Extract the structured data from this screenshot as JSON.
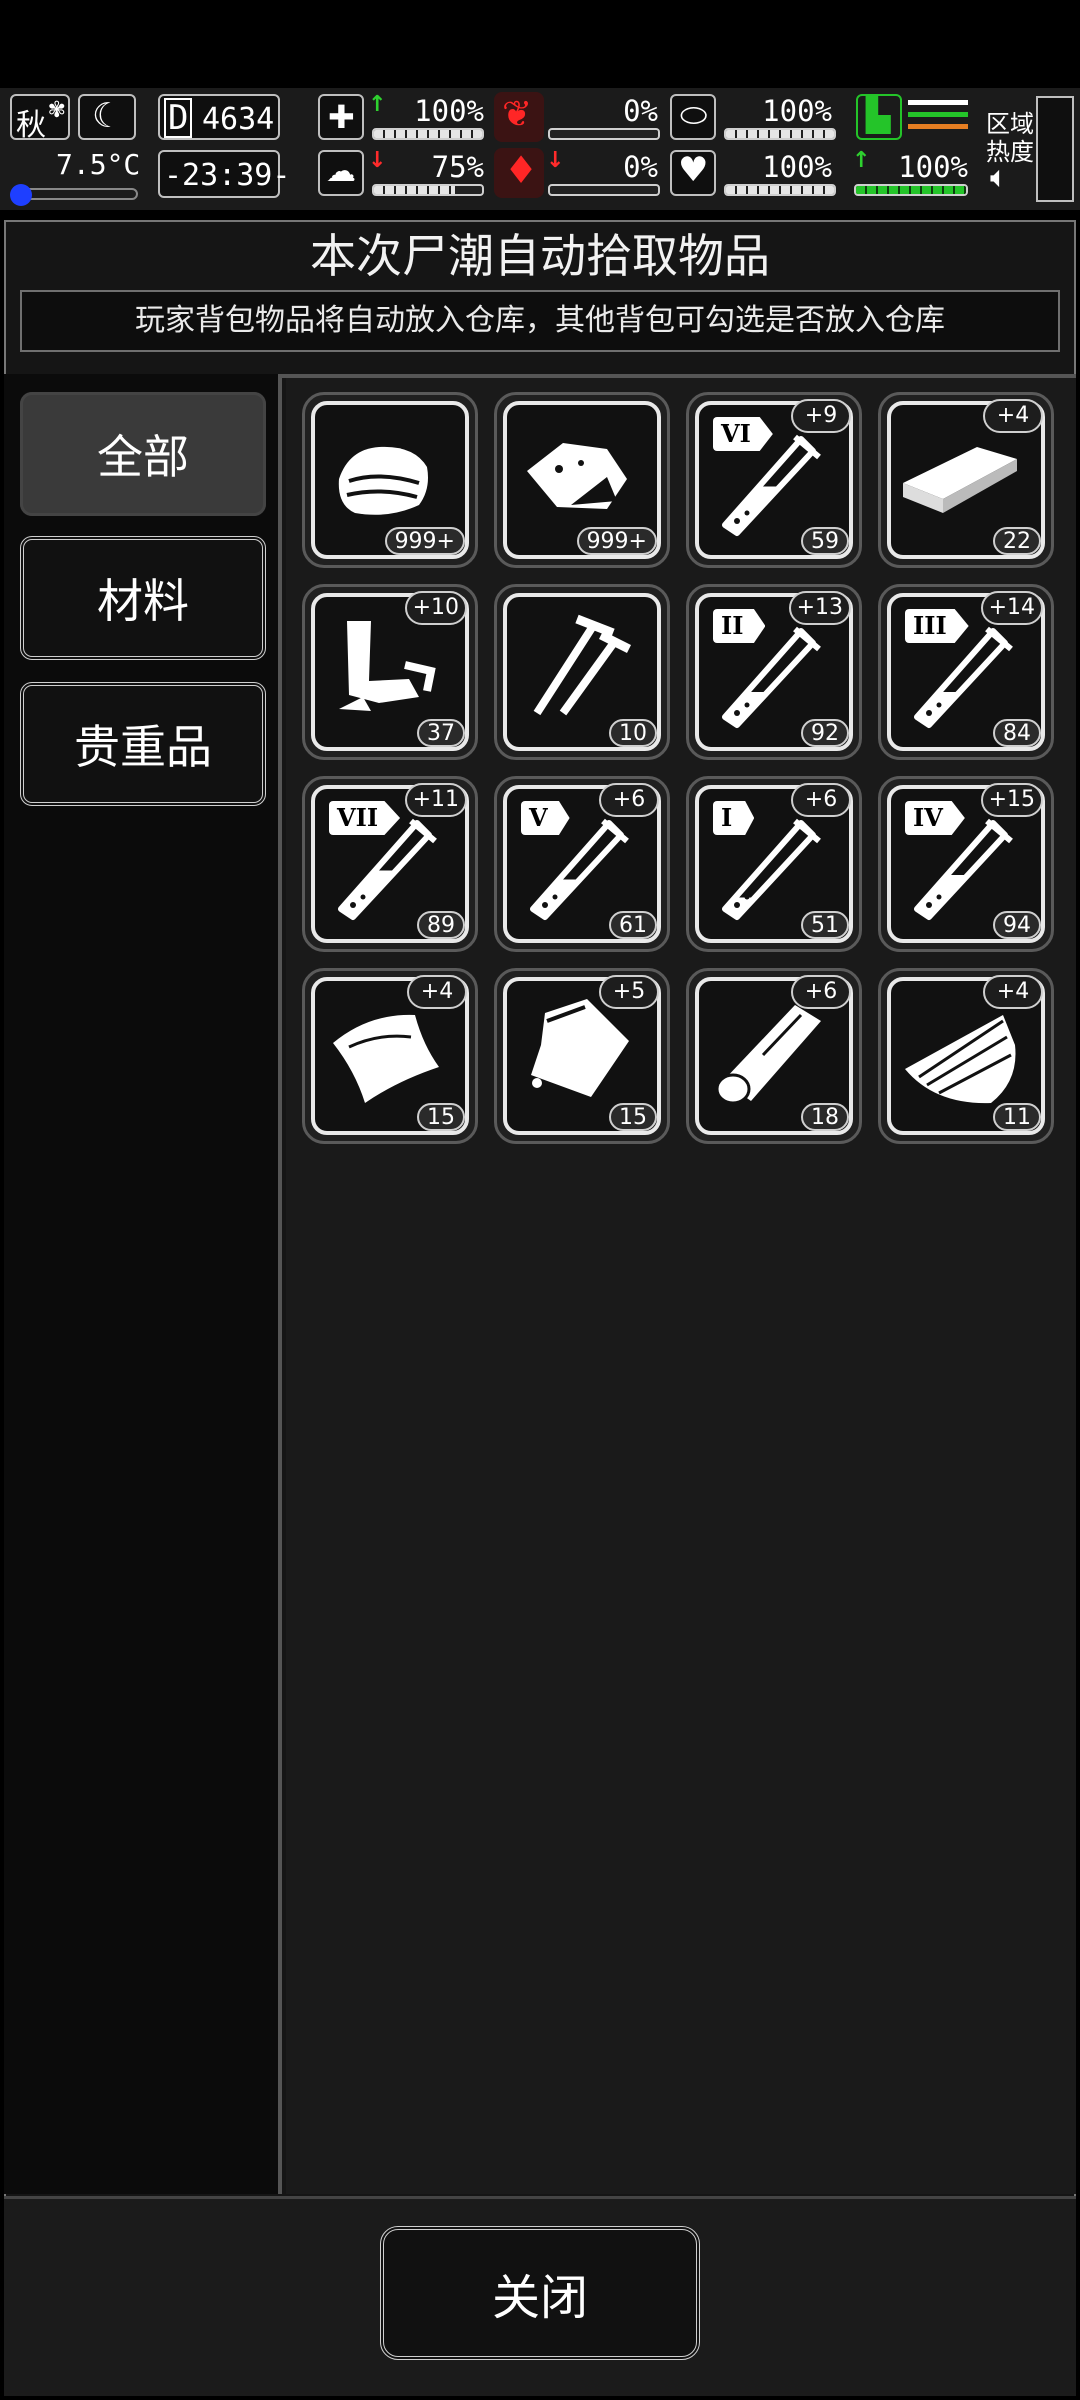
{
  "hud": {
    "season": "秋",
    "temperature": "7.5°C",
    "day_prefix": "D",
    "day": "4634",
    "time": "-23:39-",
    "zone_heat_label_1": "区域",
    "zone_heat_label_2": "热度",
    "stats": {
      "health": {
        "value": "100%",
        "fill": 1.0,
        "trend": "up"
      },
      "mental": {
        "value": "75%",
        "fill": 0.75,
        "trend": "down"
      },
      "hunger": {
        "value": "0%",
        "fill": 0.0
      },
      "blood": {
        "value": "0%",
        "fill": 0.0,
        "trend": "down"
      },
      "medicine": {
        "value": "100%",
        "fill": 1.0
      },
      "heart": {
        "value": "100%",
        "fill": 1.0
      },
      "stamina": {
        "value": "100%",
        "fill": 1.0,
        "trend": "up"
      }
    }
  },
  "dialog": {
    "title": "本次尸潮自动拾取物品",
    "subtitle": "玩家背包物品将自动放入仓库，其他背包可勾选是否放入仓库",
    "tabs": [
      {
        "label": "全部",
        "active": true
      },
      {
        "label": "材料",
        "active": false
      },
      {
        "label": "贵重品",
        "active": false
      }
    ],
    "close_label": "关闭"
  },
  "items": [
    {
      "icon": "cloth-icon",
      "count": "999+"
    },
    {
      "icon": "meat-icon",
      "count": "999+"
    },
    {
      "icon": "test-tube-icon",
      "roman": "VI",
      "bonus": "+9",
      "count": "59",
      "level": 0.45
    },
    {
      "icon": "metal-plate-icon",
      "bonus": "+4",
      "count": "22"
    },
    {
      "icon": "scrap-parts-icon",
      "bonus": "+10",
      "count": "37"
    },
    {
      "icon": "nails-icon",
      "count": "10"
    },
    {
      "icon": "test-tube-icon",
      "roman": "II",
      "bonus": "+13",
      "count": "92",
      "level": 0.3
    },
    {
      "icon": "test-tube-icon",
      "roman": "III",
      "bonus": "+14",
      "count": "84",
      "level": 0.3
    },
    {
      "icon": "test-tube-icon",
      "roman": "VII",
      "bonus": "+11",
      "count": "89",
      "level": 0.45
    },
    {
      "icon": "test-tube-icon",
      "roman": "V",
      "bonus": "+6",
      "count": "61",
      "level": 0.35
    },
    {
      "icon": "test-tube-icon",
      "roman": "I",
      "bonus": "+6",
      "count": "51",
      "level": 0.15
    },
    {
      "icon": "test-tube-icon",
      "roman": "IV",
      "bonus": "+15",
      "count": "94",
      "level": 0.4
    },
    {
      "icon": "leather-icon",
      "bonus": "+4",
      "count": "15"
    },
    {
      "icon": "bag-icon",
      "bonus": "+5",
      "count": "15"
    },
    {
      "icon": "wood-log-icon",
      "bonus": "+6",
      "count": "18"
    },
    {
      "icon": "wood-planks-icon",
      "bonus": "+4",
      "count": "11"
    }
  ]
}
